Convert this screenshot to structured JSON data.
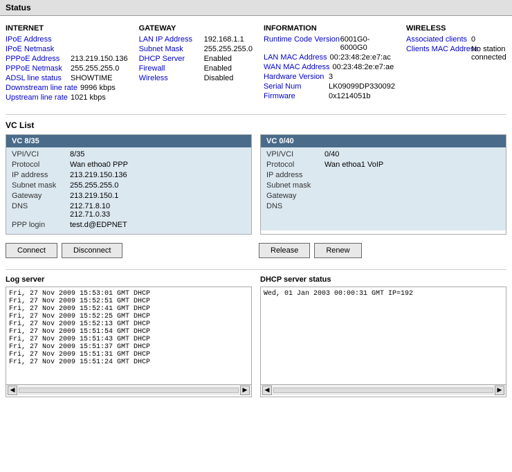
{
  "header": {
    "title": "Status"
  },
  "internet": {
    "heading": "INTERNET",
    "rows": [
      {
        "label": "IPoE Address",
        "value": ""
      },
      {
        "label": "IPoE Netmask",
        "value": ""
      },
      {
        "label": "PPPoE Address",
        "value": "213.219.150.136"
      },
      {
        "label": "PPPoE Netmask",
        "value": "255.255.255.0"
      },
      {
        "label": "ADSL line status",
        "value": "SHOWTIME"
      },
      {
        "label": "Downstream line rate",
        "value": "9996 kbps"
      },
      {
        "label": "Upstream line rate",
        "value": "1021 kbps"
      }
    ]
  },
  "gateway": {
    "heading": "GATEWAY",
    "rows": [
      {
        "label": "LAN IP Address",
        "value": "192.168.1.1"
      },
      {
        "label": "Subnet Mask",
        "value": "255.255.255.0"
      },
      {
        "label": "DHCP Server",
        "value": "Enabled"
      },
      {
        "label": "Firewall",
        "value": "Enabled"
      },
      {
        "label": "Wireless",
        "value": "Disabled"
      }
    ]
  },
  "information": {
    "heading": "INFORMATION",
    "rows": [
      {
        "label": "Runtime Code Version",
        "value": "6001G0-6000G0"
      },
      {
        "label": "LAN MAC Address",
        "value": "00:23:48:2e:e7:ac"
      },
      {
        "label": "WAN MAC Address",
        "value": "00:23:48:2e:e7:ae"
      },
      {
        "label": "Hardware Version",
        "value": "3"
      },
      {
        "label": "Serial Num",
        "value": "LK09099DP330092"
      },
      {
        "label": "Firmware",
        "value": "0x1214051b"
      }
    ]
  },
  "wireless": {
    "heading": "WIRELESS",
    "rows": [
      {
        "label": "Associated clients",
        "value": "0"
      },
      {
        "label": "Clients MAC Address",
        "value": "No station connected"
      }
    ]
  },
  "vc_list": {
    "title": "VC List",
    "vc1": {
      "title": "VC 8/35",
      "rows": [
        {
          "label": "VPI/VCI",
          "value": "8/35"
        },
        {
          "label": "Protocol",
          "value": "Wan ethoa0 PPP"
        },
        {
          "label": "IP address",
          "value": "213.219.150.136"
        },
        {
          "label": "Subnet mask",
          "value": "255.255.255.0"
        },
        {
          "label": "Gateway",
          "value": "213.219.150.1"
        },
        {
          "label": "DNS",
          "value": "212.71.8.10\n212.71.0.33"
        },
        {
          "label": "PPP login",
          "value": "test.d@EDPNET"
        }
      ]
    },
    "vc2": {
      "title": "VC 0/40",
      "rows": [
        {
          "label": "VPI/VCI",
          "value": "0/40"
        },
        {
          "label": "Protocol",
          "value": "Wan ethoa1 VoIP"
        },
        {
          "label": "IP address",
          "value": ""
        },
        {
          "label": "Subnet mask",
          "value": ""
        },
        {
          "label": "Gateway",
          "value": ""
        },
        {
          "label": "DNS",
          "value": ""
        }
      ]
    }
  },
  "buttons": {
    "vc1": {
      "connect": "Connect",
      "disconnect": "Disconnect"
    },
    "vc2": {
      "release": "Release",
      "renew": "Renew"
    }
  },
  "log_server": {
    "title": "Log server",
    "lines": [
      "Fri, 27 Nov 2009 15:53:01 GMT DHCP",
      "Fri, 27 Nov 2009 15:52:51 GMT DHCP",
      "Fri, 27 Nov 2009 15:52:41 GMT DHCP",
      "Fri, 27 Nov 2009 15:52:25 GMT DHCP",
      "Fri, 27 Nov 2009 15:52:13 GMT DHCP",
      "Fri, 27 Nov 2009 15:51:54 GMT DHCP",
      "Fri, 27 Nov 2009 15:51:43 GMT DHCP",
      "Fri, 27 Nov 2009 15:51:37 GMT DHCP",
      "Fri, 27 Nov 2009 15:51:31 GMT DHCP",
      "Fri, 27 Nov 2009 15:51:24 GMT DHCP"
    ]
  },
  "dhcp_server": {
    "title": "DHCP server status",
    "lines": [
      "Wed, 01 Jan 2003 00:00:31 GMT IP=192"
    ]
  }
}
